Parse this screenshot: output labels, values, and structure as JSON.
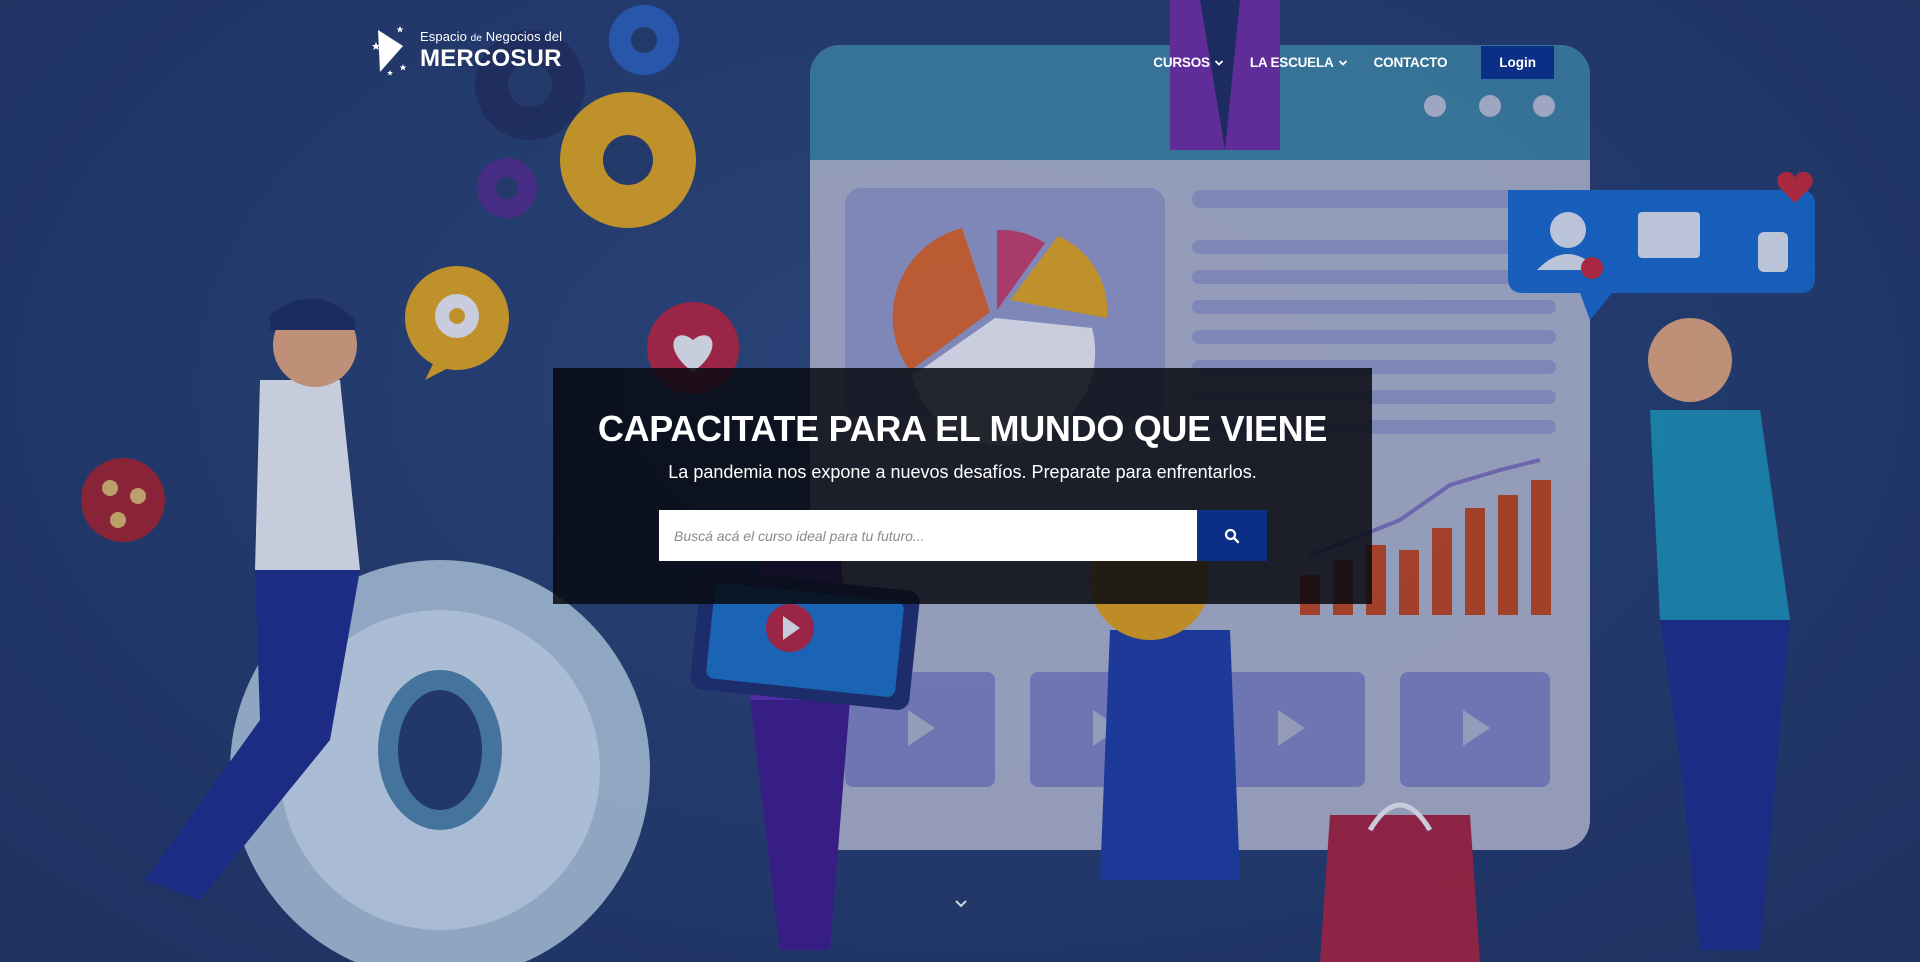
{
  "header": {
    "logo": {
      "line1": "Espacio",
      "line1_de": "de",
      "line1_rest": "Negocios del",
      "line2": "MERCOSUR"
    },
    "nav": [
      {
        "label": "CURSOS",
        "has_dropdown": true
      },
      {
        "label": "LA ESCUELA",
        "has_dropdown": true
      },
      {
        "label": "CONTACTO",
        "has_dropdown": false
      }
    ],
    "login_label": "Login"
  },
  "hero": {
    "title": "CAPACITATE PARA EL MUNDO QUE VIENE",
    "subtitle": "La pandemia nos expone a nuevos desafíos. Preparate para enfrentarlos.",
    "search": {
      "placeholder": "Buscá acá el curso ideal para tu futuro...",
      "value": "",
      "button_icon": "search-icon"
    },
    "scroll_icon": "chevron-down-icon"
  },
  "colors": {
    "background": "#233a6b",
    "accent": "#0b2f86",
    "overlay": "#080a12"
  }
}
